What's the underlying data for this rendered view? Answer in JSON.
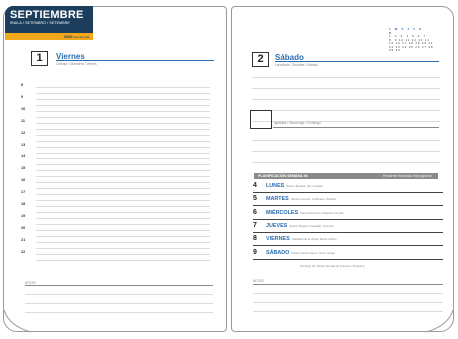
{
  "month": {
    "name": "SEPTIEMBRE",
    "subtitle": "IRAILA / SETEMBRO / SETEMBRE",
    "year": "2025",
    "week": "Semana 36"
  },
  "left_day": {
    "number": "1",
    "name": "Viernes",
    "sub": "Ostirala / Divendres / Venres"
  },
  "hours": [
    "8",
    "9",
    "10",
    "11",
    "12",
    "13",
    "14",
    "15",
    "16",
    "17",
    "18",
    "19",
    "20",
    "21",
    "22"
  ],
  "notes_label": "NOTAS",
  "right_day": {
    "number": "2",
    "name": "Sábado",
    "sub": "Larunbata / Dissabte / Sábado"
  },
  "sunday": {
    "sub": "Igandea / Diumenge / Domingo"
  },
  "mini_calendar": {
    "header": "L M X J V S D",
    "rows": [
      "1  2  3  4  5  6  7",
      "8  9 10 11 12 13 14",
      "15 16 17 18 19 20 21",
      "22 23 24 25 26 27 28",
      "29 30"
    ]
  },
  "planning": {
    "title": "PLANIFICACIÓN SEMANA 36",
    "columns": "Pendiente    Realizado    Reprogramar",
    "rows": [
      {
        "num": "4",
        "day": "LUNES",
        "saint": "Santos Rosalía, Ida, Candida"
      },
      {
        "num": "5",
        "day": "MARTES",
        "saint": "Santos Lorenzo, Justiniano, Obdulia"
      },
      {
        "num": "6",
        "day": "MIÉRCOLES",
        "saint": "Santos Eleuterio, Zacarías, Donato"
      },
      {
        "num": "7",
        "day": "JUEVES",
        "saint": "Santos Regina, Clodoaldo, Sozonte"
      },
      {
        "num": "8",
        "day": "VIERNES",
        "saint": "Natividad de la Virgen María, Adrián"
      },
      {
        "num": "9",
        "day": "SÁBADO",
        "saint": "Santos Pedro Claver, Omar, Sergio"
      }
    ],
    "extra": "Domingo 10: Santos Nicolás de Tolentino, Pulqueria"
  }
}
